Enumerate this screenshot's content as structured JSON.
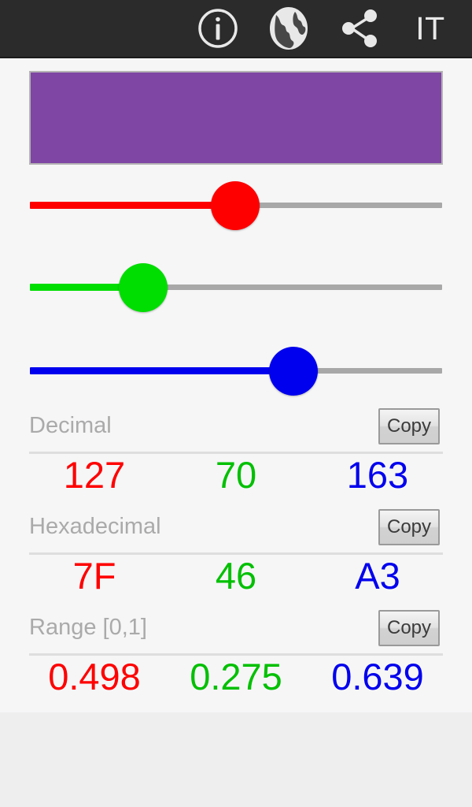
{
  "appbar": {
    "background": "#2b2b2b",
    "actions": [
      {
        "name": "info-icon",
        "label": "Info"
      },
      {
        "name": "globe-icon",
        "label": "Language"
      },
      {
        "name": "share-icon",
        "label": "Share"
      }
    ],
    "language_code": "IT"
  },
  "preview": {
    "swatch_color": "#7F46A3",
    "border_color": "#b4b4b4"
  },
  "sliders": [
    {
      "channel": "red",
      "color": "#ff0000",
      "value": 127,
      "min": 0,
      "max": 255,
      "percent": 49.8
    },
    {
      "channel": "green",
      "color": "#00dd00",
      "value": 70,
      "min": 0,
      "max": 255,
      "percent": 27.5
    },
    {
      "channel": "blue",
      "color": "#0000ee",
      "value": 163,
      "min": 0,
      "max": 255,
      "percent": 63.9
    }
  ],
  "rows": [
    {
      "label": "Decimal",
      "copy_label": "Copy",
      "red": "127",
      "green": "70",
      "blue": "163"
    },
    {
      "label": "Hexadecimal",
      "copy_label": "Copy",
      "red": "7F",
      "green": "46",
      "blue": "A3"
    },
    {
      "label": "Range [0,1]",
      "copy_label": "Copy",
      "red": "0.498",
      "green": "0.275",
      "blue": "0.639"
    }
  ],
  "colors": {
    "red_text": "#ff0000",
    "green_text": "#00c000",
    "blue_text": "#0000ee",
    "label_text": "#aaaaaa",
    "content_bg": "#f6f6f7",
    "page_bg": "#eeeeee",
    "track_bg": "#a8a8a8"
  }
}
